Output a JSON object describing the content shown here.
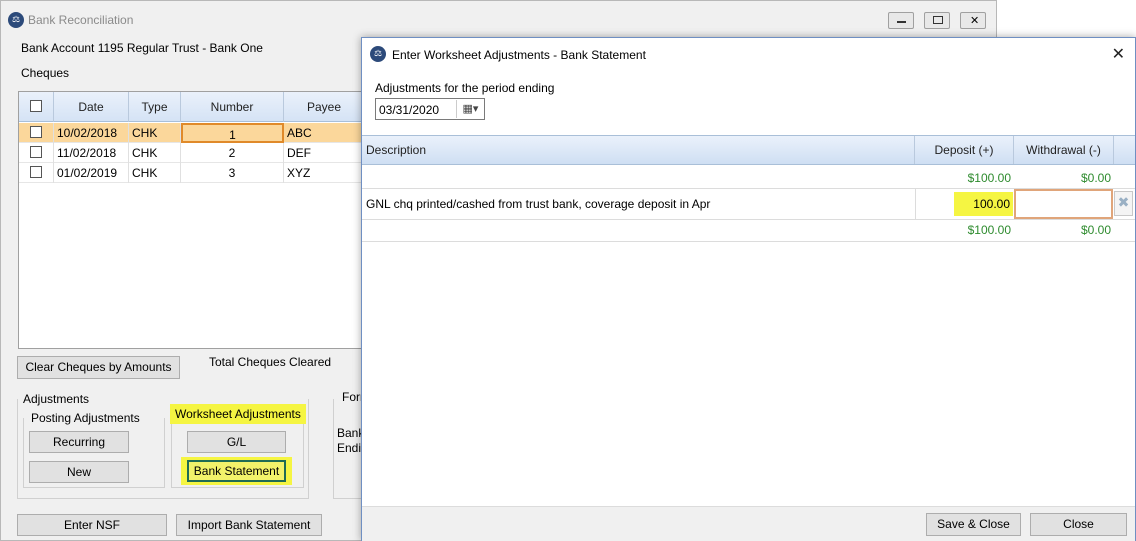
{
  "background_window": {
    "title": "Bank Reconciliation",
    "app_icon": "scales-icon",
    "account_label": "Bank Account 1195 Regular Trust - Bank One",
    "cheques_label": "Cheques",
    "grid": {
      "columns": [
        "Date",
        "Type",
        "Number",
        "Payee"
      ],
      "rows": [
        {
          "date": "10/02/2018",
          "type": "CHK",
          "number": "1",
          "payee": "ABC",
          "selected": true
        },
        {
          "date": "11/02/2018",
          "type": "CHK",
          "number": "2",
          "payee": "DEF",
          "selected": false
        },
        {
          "date": "01/02/2019",
          "type": "CHK",
          "number": "3",
          "payee": "XYZ",
          "selected": false
        }
      ]
    },
    "clear_cheques_button": "Clear Cheques by Amounts",
    "total_cheques_cleared": "Total Cheques Cleared",
    "adjustments_label": "Adjustments",
    "posting_adjustments_label": "Posting Adjustments",
    "recurring_button": "Recurring",
    "new_button": "New",
    "worksheet_adjustments_label": "Worksheet Adjustments",
    "gl_button": "G/L",
    "bank_statement_button": "Bank Statement",
    "form_label_partial": "Forr",
    "bank_partial": "Bank",
    "ending_partial": "Endi",
    "enter_nsf_button": "Enter NSF",
    "import_bank_statement_button": "Import Bank Statement"
  },
  "dialog": {
    "title": "Enter Worksheet Adjustments - Bank Statement",
    "period_label": "Adjustments for the period ending",
    "period_date": "03/31/2020",
    "columns": {
      "description": "Description",
      "deposit": "Deposit (+)",
      "withdrawal": "Withdrawal (-)"
    },
    "top_totals": {
      "deposit": "$100.00",
      "withdrawal": "$0.00"
    },
    "rows": [
      {
        "description": "GNL chq printed/cashed from trust bank, coverage deposit in Apr",
        "deposit": "100.00",
        "withdrawal": ""
      }
    ],
    "bottom_totals": {
      "deposit": "$100.00",
      "withdrawal": "$0.00"
    },
    "save_close_button": "Save & Close",
    "close_button": "Close"
  },
  "colors": {
    "highlight": "#f5f542",
    "selected_row": "#fbd79b",
    "green_total": "#2e8b2e",
    "dialog_border": "#6f8fc2"
  }
}
